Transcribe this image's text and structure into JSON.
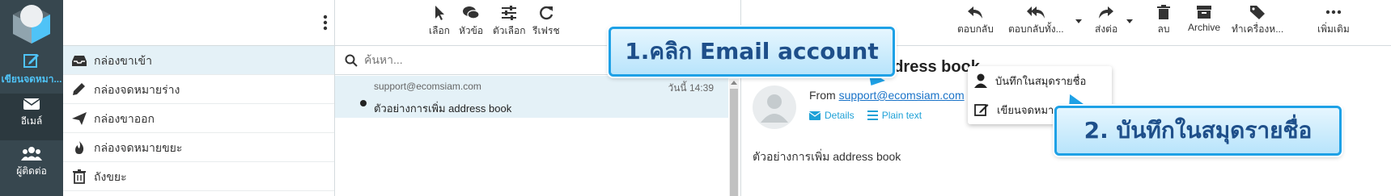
{
  "rail": {
    "compose_label": "เขียนจดหมา...",
    "mail_label": "อีเมล์",
    "contacts_label": "ผู้ติดต่อ"
  },
  "folders": [
    {
      "label": "กล่องขาเข้า",
      "icon": "inbox-icon"
    },
    {
      "label": "กล่องจดหมายร่าง",
      "icon": "pencil-icon"
    },
    {
      "label": "กล่องขาออก",
      "icon": "send-icon"
    },
    {
      "label": "กล่องจดหมายขยะ",
      "icon": "fire-icon"
    },
    {
      "label": "ถังขยะ",
      "icon": "trash-icon"
    }
  ],
  "list_toolbar": {
    "select": "เลือก",
    "threads": "หัวข้อ",
    "options": "ตัวเลือก",
    "refresh": "รีเฟรช"
  },
  "search": {
    "placeholder": "ค้นหา..."
  },
  "message": {
    "from": "support@ecomsiam.com",
    "date": "วันนี้ 14:39",
    "subject": "ตัวอย่างการเพิ่ม address book"
  },
  "read_toolbar": {
    "reply": "ตอบกลับ",
    "reply_all": "ตอบกลับทั้ง...",
    "forward": "ส่งต่อ",
    "delete": "ลบ",
    "archive": "Archive",
    "mark": "ทำเครื่องห...",
    "more": "เพิ่มเติม"
  },
  "reading": {
    "title_fragment": "ddress book",
    "from_prefix": "From",
    "from_email": "support@ecomsiam.com",
    "details": "Details",
    "plain_text": "Plain text",
    "body": "ตัวอย่างการเพิ่ม address book"
  },
  "popup": {
    "add_contact": "บันทึกในสมุดรายชื่อ",
    "compose_to": "เขียนจดหมาย"
  },
  "callouts": {
    "step1": "1.คลิก Email account",
    "step2": "2. บันทึกในสมุดรายชื่อ"
  },
  "colors": {
    "rail": "#37474f",
    "accent": "#1ea1e6",
    "selected_row": "#e4f1f7",
    "callout_text": "#1e4f8a"
  }
}
